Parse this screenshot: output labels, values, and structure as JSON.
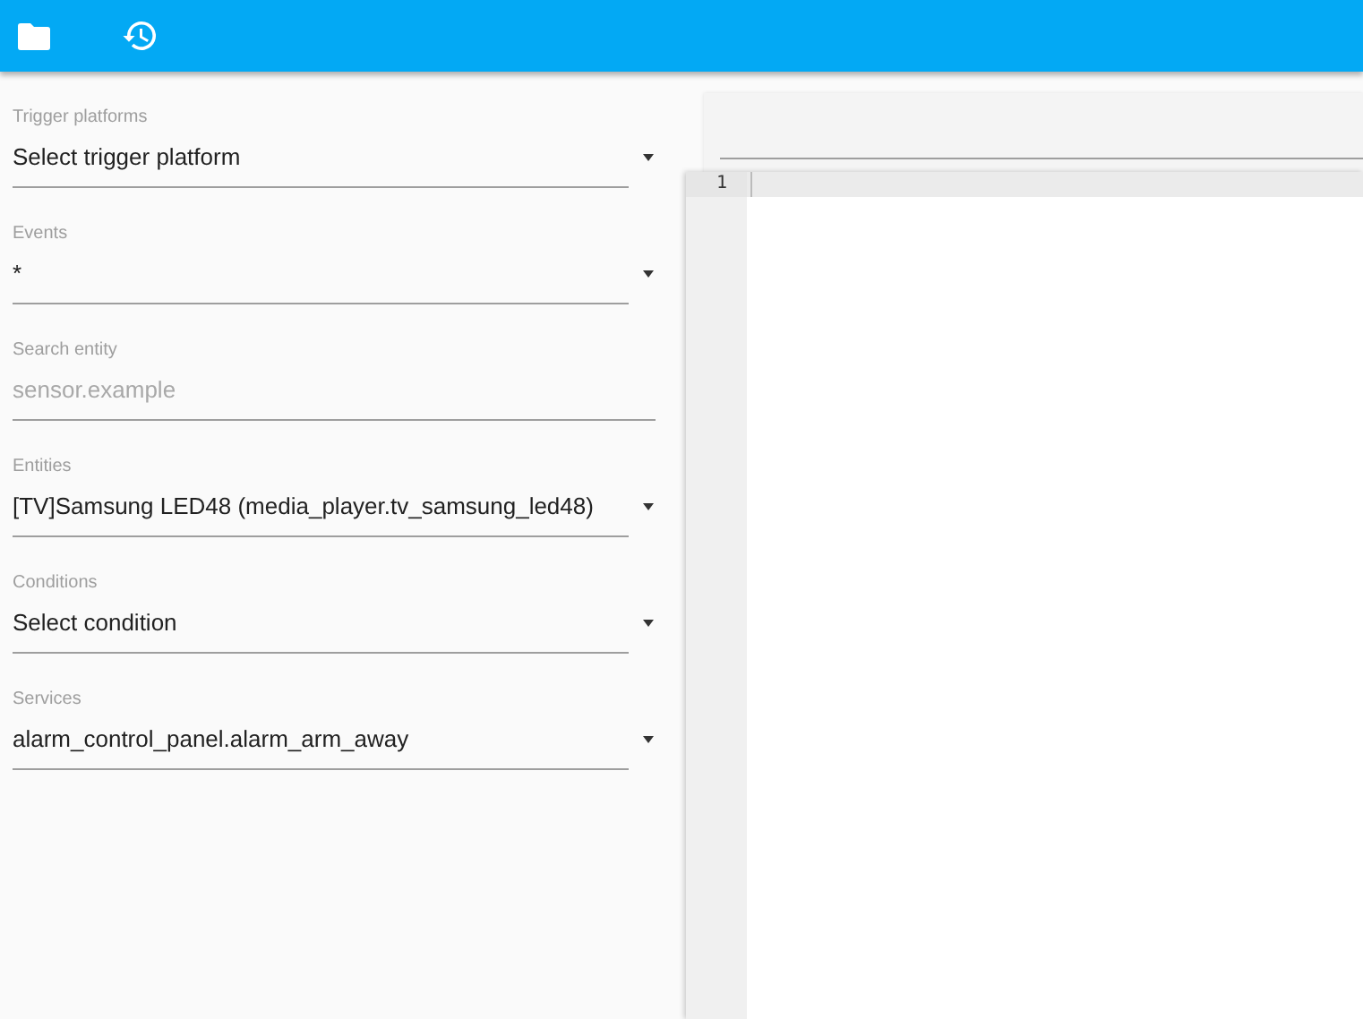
{
  "toolbar": {
    "buttons": [
      {
        "kind": "folder"
      },
      {
        "kind": "history"
      }
    ]
  },
  "form": {
    "fields": [
      {
        "kind": "select",
        "label": "Trigger platforms",
        "value": "Select trigger platform"
      },
      {
        "kind": "select",
        "label": "Events",
        "value": "*"
      },
      {
        "kind": "text",
        "label": "Search entity",
        "placeholder": "sensor.example"
      },
      {
        "kind": "select",
        "label": "Entities",
        "value": "[TV]Samsung LED48 (media_player.tv_samsung_led48)"
      },
      {
        "kind": "select",
        "label": "Conditions",
        "value": "Select condition"
      },
      {
        "kind": "select",
        "label": "Services",
        "value": "alarm_control_panel.alarm_arm_away"
      }
    ]
  },
  "editor": {
    "line_numbers": [
      "1"
    ]
  }
}
